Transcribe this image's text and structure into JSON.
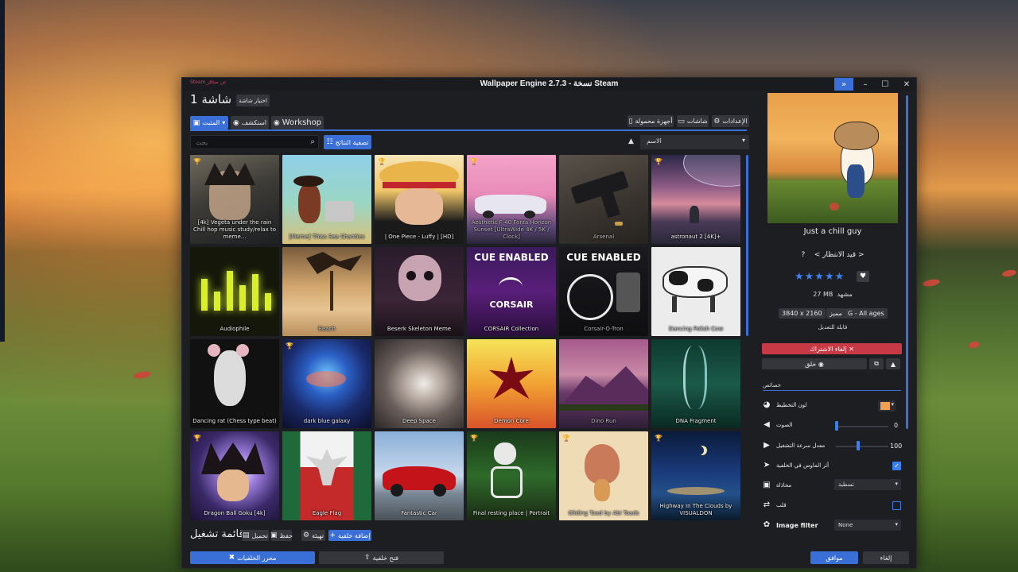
{
  "window": {
    "title": "Wallpaper Engine 2.7.3 - نسخة Steam",
    "corner_text": "Steam_عن ميثاق"
  },
  "toolbar": {
    "screen_title": "شاشة 1",
    "choose_screen": "اختيار شاشة",
    "tabs": [
      "المثبت",
      "استكشف",
      "Workshop"
    ],
    "settings": "الإعدادات",
    "screens": "شاشات",
    "portable": "أجهزة محمولة",
    "filter_results": "تصفية النتائج"
  },
  "search": {
    "placeholder": "بحث"
  },
  "sort": {
    "selected": "الاسم"
  },
  "wallpapers": [
    {
      "title": "[4k] Vegeta under the rain Chill hop music study/relax to meme...",
      "trophy": true
    },
    {
      "title": "[Meme] Thiss Sea Shanties",
      "trophy": false,
      "dim": true
    },
    {
      "title": "| One Piece - Luffy | [HD]",
      "trophy": true
    },
    {
      "title": "Aesthetic F-40 Forza Horizon Sunset [UltraWide 4K / 5K / Clock]",
      "trophy": true,
      "dim": true
    },
    {
      "title": "Arsenal",
      "trophy": false,
      "dim": true
    },
    {
      "title": "astronaut 2 [4K]+",
      "trophy": true
    },
    {
      "title": "Audiophile",
      "trophy": false
    },
    {
      "title": "Beach",
      "trophy": false,
      "dim": true
    },
    {
      "title": "Beserk Skeleton Meme",
      "trophy": false
    },
    {
      "title": "CORSAIR Collection",
      "trophy": false
    },
    {
      "title": "Corsair-O-Tron",
      "trophy": false,
      "dim": true
    },
    {
      "title": "Dancing Polish Cow",
      "trophy": false,
      "dim": true
    },
    {
      "title": "Dancing rat (Chess type beat)",
      "trophy": false
    },
    {
      "title": "dark blue galaxy",
      "trophy": true
    },
    {
      "title": "Deep Space",
      "trophy": false
    },
    {
      "title": "Demon Core",
      "trophy": false
    },
    {
      "title": "Dino Run",
      "trophy": false,
      "dim": true
    },
    {
      "title": "DNA Fragment",
      "trophy": false
    },
    {
      "title": "Dragon Ball Goku [4k]",
      "trophy": true
    },
    {
      "title": "Eagle Flag",
      "trophy": false
    },
    {
      "title": "Fantastic Car",
      "trophy": false
    },
    {
      "title": "Final resting place | Portrait",
      "trophy": true
    },
    {
      "title": "Gliding Toad by Abi Toads",
      "trophy": true,
      "dim": true
    },
    {
      "title": "Highway In The Clouds by VISUALDON",
      "trophy": true
    }
  ],
  "tile_badges": {
    "cue": "CUE ENABLED",
    "corsair": "CORSAIR"
  },
  "playlist": {
    "title": "قائمة تشغيل",
    "load": "تحميل",
    "save": "حفظ",
    "configure": "تهيئة",
    "add_wallpaper": "إضافة خلفية"
  },
  "bottom": {
    "editor": "محرر الخلفيات",
    "open_wallpaper": "فتح خلفية",
    "ok": "موافق",
    "cancel": "إلغاء"
  },
  "details": {
    "title": "Just a chill guy",
    "status": "< قيد الانتظار >",
    "question": "?",
    "stars": "★★★★★",
    "size": "27 MB",
    "size_label": "مشهد",
    "resolution": "3840 x 2160",
    "featured": "مميز",
    "rating": "G - All ages",
    "editable": "قابلة للتعديل",
    "unsubscribe": "إلغاء الاشتراك",
    "share": "خلق"
  },
  "properties": {
    "header": "خصائص",
    "scheme_color": "لون التخطيط",
    "volume": "الصوت",
    "volume_value": 0,
    "playback_rate": "معدل سرعة التشغيل",
    "playback_value": 100,
    "mouse_bg": "أثر الماوس في الخلفية",
    "alignment": "محاذاة",
    "alignment_value": "تسطية",
    "flip": "قلب",
    "image_filter": "Image filter",
    "image_filter_value": "None"
  },
  "colors": {
    "accent": "#3a6fd8",
    "danger": "#c73a45",
    "star": "#3f7ff0",
    "scheme": "#f0a050"
  }
}
